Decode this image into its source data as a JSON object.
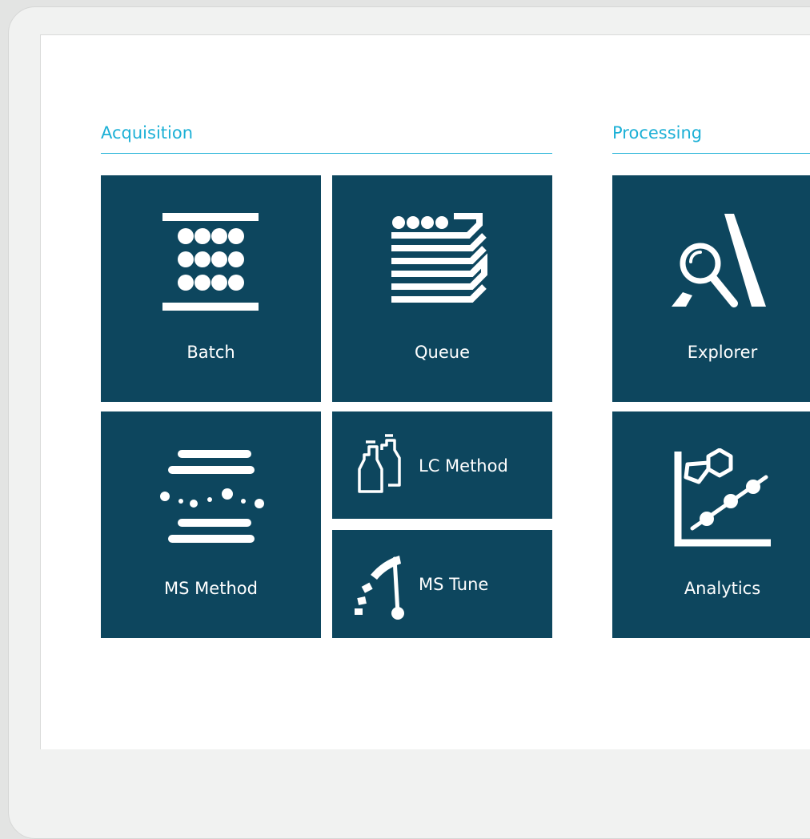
{
  "theme": {
    "accent": "#1cb0d6",
    "tile": "#0d465e",
    "background": "#ffffff",
    "frame": "#f1f2f1"
  },
  "sections": {
    "acquisition": {
      "title": "Acquisition"
    },
    "processing": {
      "title": "Processing"
    }
  },
  "tiles": {
    "batch": {
      "label": "Batch",
      "icon": "batch-plate-icon"
    },
    "queue": {
      "label": "Queue",
      "icon": "queue-stack-icon"
    },
    "ms_method": {
      "label": "MS Method",
      "icon": "ms-method-icon"
    },
    "lc_method": {
      "label": "LC Method",
      "icon": "solvent-bottles-icon"
    },
    "ms_tune": {
      "label": "MS Tune",
      "icon": "tune-gauge-icon"
    },
    "explorer": {
      "label": "Explorer",
      "icon": "explorer-magnifier-icon"
    },
    "analytics": {
      "label": "Analytics",
      "icon": "analytics-chart-icon"
    }
  }
}
